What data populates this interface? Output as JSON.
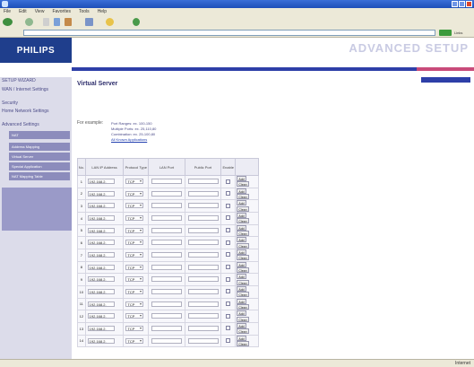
{
  "window": {
    "title": ""
  },
  "menu": [
    "File",
    "Edit",
    "View",
    "Favorites",
    "Tools",
    "Help"
  ],
  "address": {
    "links_label": "Links"
  },
  "brand": {
    "logo": "PHILIPS",
    "header": "ADVANCED SETUP"
  },
  "sidebar": {
    "items": [
      "SETUP WIZARD",
      "WAN / Internet Settings",
      "Security",
      "Home Network Settings",
      "Advanced Settings"
    ],
    "sub": [
      "NAT",
      "Address Mapping",
      "Virtual Server",
      "Special Application",
      "NAT Mapping Table"
    ]
  },
  "main": {
    "title": "Virtual Server",
    "intro": "",
    "examples_label": "For example:",
    "examples": [
      "Port Ranges: ex. 100-150",
      "Multiple Ports: ex. 25,110,80",
      "Combination: ex. 25-100,80"
    ],
    "more_link": "All Known Applications"
  },
  "table": {
    "headers": [
      "No.",
      "LAN IP Address",
      "Protocol Type",
      "LAN Port",
      "Public Port",
      "Enable",
      ""
    ],
    "rows": [
      {
        "no": "1",
        "ip": "192.168.2.",
        "proto": "TCP"
      },
      {
        "no": "2",
        "ip": "192.168.2.",
        "proto": "TCP"
      },
      {
        "no": "3",
        "ip": "192.168.2.",
        "proto": "TCP"
      },
      {
        "no": "4",
        "ip": "192.168.2.",
        "proto": "TCP"
      },
      {
        "no": "5",
        "ip": "192.168.2.",
        "proto": "TCP"
      },
      {
        "no": "6",
        "ip": "192.168.2.",
        "proto": "TCP"
      },
      {
        "no": "7",
        "ip": "192.168.2.",
        "proto": "TCP"
      },
      {
        "no": "8",
        "ip": "192.168.2.",
        "proto": "TCP"
      },
      {
        "no": "9",
        "ip": "192.168.2.",
        "proto": "TCP"
      },
      {
        "no": "10",
        "ip": "192.168.2.",
        "proto": "TCP"
      },
      {
        "no": "11",
        "ip": "192.168.2.",
        "proto": "TCP"
      },
      {
        "no": "12",
        "ip": "192.168.2.",
        "proto": "TCP"
      },
      {
        "no": "13",
        "ip": "192.168.2.",
        "proto": "TCP"
      },
      {
        "no": "14",
        "ip": "192.168.2.",
        "proto": "TCP"
      }
    ],
    "add_label": "Add",
    "clean_label": "Clean"
  },
  "status": {
    "zone": "Internet"
  },
  "colors": {
    "brand": "#1f3e8c",
    "nav": "#2e3fa8",
    "accent": "#c94b7a",
    "sidebar_bg": "#dcdcea"
  }
}
